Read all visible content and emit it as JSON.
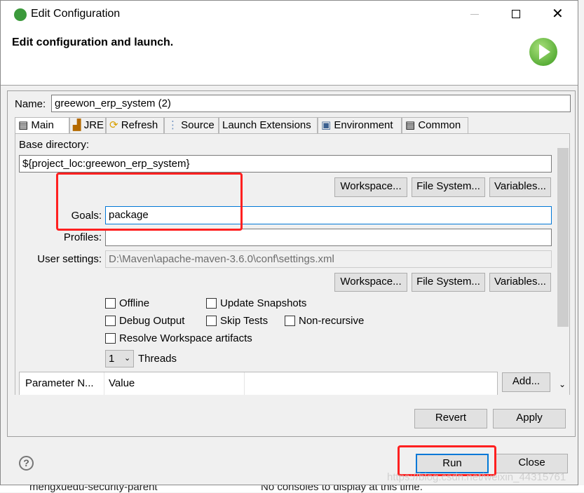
{
  "window": {
    "title": "Edit Configuration",
    "header": "Edit configuration and launch."
  },
  "name": {
    "label": "Name:",
    "value": "greewon_erp_system (2)"
  },
  "tabs": [
    {
      "label": "Main"
    },
    {
      "label": "JRE"
    },
    {
      "label": "Refresh"
    },
    {
      "label": "Source"
    },
    {
      "label": "Launch Extensions"
    },
    {
      "label": "Environment"
    },
    {
      "label": "Common"
    }
  ],
  "main": {
    "base_dir_label": "Base directory:",
    "base_dir_value": "${project_loc:greewon_erp_system}",
    "workspace": "Workspace...",
    "filesystem": "File System...",
    "variables": "Variables...",
    "goals_label": "Goals:",
    "goals_value": "package",
    "profiles_label": "Profiles:",
    "profiles_value": "",
    "user_settings_label": "User settings:",
    "user_settings_value": "D:\\Maven\\apache-maven-3.6.0\\conf\\settings.xml",
    "checkboxes": {
      "offline": "Offline",
      "update": "Update Snapshots",
      "debug": "Debug Output",
      "skip": "Skip Tests",
      "nonrec": "Non-recursive",
      "resolve": "Resolve Workspace artifacts"
    },
    "threads_value": "1",
    "threads_label": "Threads",
    "table_headers": [
      "Parameter N...",
      "Value"
    ],
    "add": "Add..."
  },
  "buttons": {
    "revert": "Revert",
    "apply": "Apply",
    "run": "Run",
    "close": "Close"
  },
  "background": {
    "project": "mengxuedu-security-parent",
    "console": "No consoles to display at this time.",
    "watermark": "https://blog.csdn.net/weixin_44315761"
  },
  "colors": {
    "highlight": "#ff2020",
    "focus": "#0078d7"
  }
}
